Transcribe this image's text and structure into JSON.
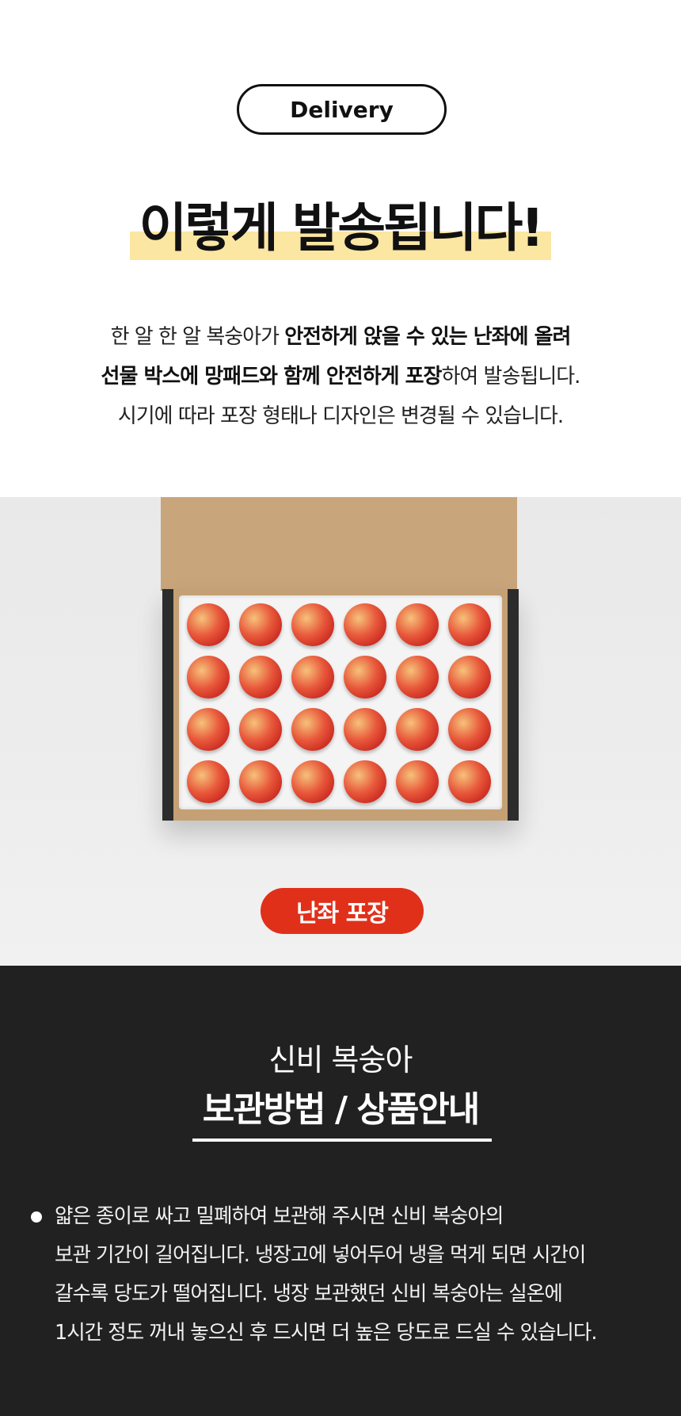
{
  "header": {
    "pill_label": "Delivery",
    "headline": "이렇게 발송됩니다!",
    "desc_line1_a": "한 알 한 알 복숭아가 ",
    "desc_line1_b": "안전하게 앉을 수 있는 난좌에 올려",
    "desc_line2_a": "선물 박스에 망패드와 함께 안전하게 포장",
    "desc_line2_b": "하여 발송됩니다.",
    "desc_line3": "시기에 따라 포장 형태나 디자인은 변경될 수 있습니다."
  },
  "photo": {
    "badge_label": "난좌 포장",
    "tray_rows": 4,
    "tray_cols": 6
  },
  "storage": {
    "subtitle": "신비 복숭아",
    "title": "보관방법 / 상품안내",
    "lines": [
      "얇은 종이로 싸고 밀폐하여 보관해 주시면 신비 복숭아의",
      "보관 기간이 길어집니다. 냉장고에 넣어두어 냉을 먹게 되면 시간이",
      "갈수록 당도가 떨어집니다. 냉장 보관했던 신비 복숭아는 실온에",
      "1시간 정도 꺼내 놓으신 후 드시면 더 높은 당도로 드실 수 있습니다."
    ]
  },
  "colors": {
    "highlight": "#fbe6a2",
    "badge": "#e1301a",
    "dark_bg": "#212121"
  }
}
